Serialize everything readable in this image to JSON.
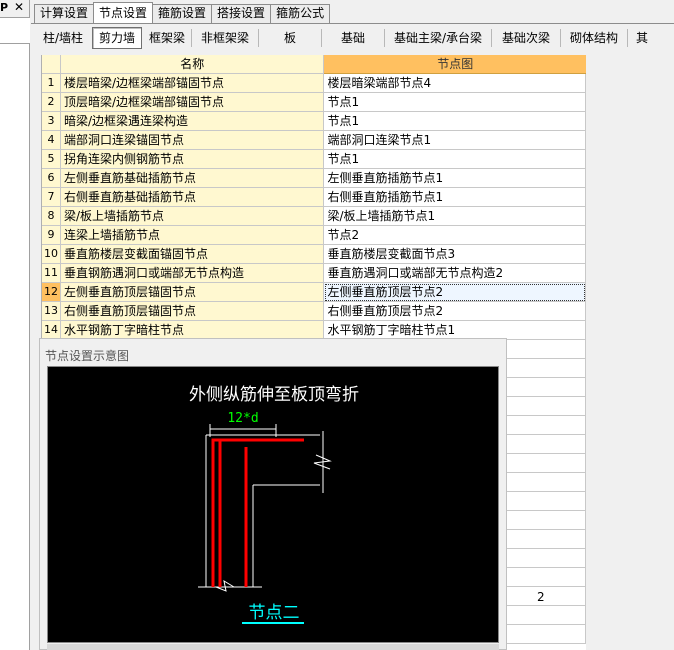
{
  "left_panel": {
    "glyph": "P",
    "close": "✕"
  },
  "tabs": [
    {
      "label": "计算设置",
      "active": false
    },
    {
      "label": "节点设置",
      "active": true
    },
    {
      "label": "箍筋设置",
      "active": false
    },
    {
      "label": "搭接设置",
      "active": false
    },
    {
      "label": "箍筋公式",
      "active": false
    }
  ],
  "subtabs": [
    {
      "label": "柱/墙柱",
      "active": false
    },
    {
      "label": "剪力墙",
      "active": true
    },
    {
      "label": "框架梁",
      "active": false
    },
    {
      "label": "非框架梁",
      "active": false
    },
    {
      "label": "板",
      "active": false
    },
    {
      "label": "基础",
      "active": false
    },
    {
      "label": "基础主梁/承台梁",
      "active": false
    },
    {
      "label": "基础次梁",
      "active": false
    },
    {
      "label": "砌体结构",
      "active": false
    },
    {
      "label": "其",
      "active": false
    }
  ],
  "table": {
    "headers": {
      "name": "名称",
      "node": "节点图"
    },
    "selected_row": 12,
    "rows": [
      {
        "num": "1",
        "name": "楼层暗梁/边框梁端部锚固节点",
        "node": "楼层暗梁端部节点4"
      },
      {
        "num": "2",
        "name": "顶层暗梁/边框梁端部锚固节点",
        "node": "节点1"
      },
      {
        "num": "3",
        "name": "暗梁/边框梁遇连梁构造",
        "node": "节点1"
      },
      {
        "num": "4",
        "name": "端部洞口连梁锚固节点",
        "node": "端部洞口连梁节点1"
      },
      {
        "num": "5",
        "name": "拐角连梁内侧钢筋节点",
        "node": "节点1"
      },
      {
        "num": "6",
        "name": "左侧垂直筋基础插筋节点",
        "node": "左侧垂直筋插筋节点1"
      },
      {
        "num": "7",
        "name": "右侧垂直筋基础插筋节点",
        "node": "右侧垂直筋插筋节点1"
      },
      {
        "num": "8",
        "name": "梁/板上墙插筋节点",
        "node": "梁/板上墙插筋节点1"
      },
      {
        "num": "9",
        "name": "连梁上墙插筋节点",
        "node": "节点2"
      },
      {
        "num": "10",
        "name": "垂直筋楼层变截面锚固节点",
        "node": "垂直筋楼层变截面节点3"
      },
      {
        "num": "11",
        "name": "垂直钢筋遇洞口或端部无节点构造",
        "node": "垂直筋遇洞口或端部无节点构造2"
      },
      {
        "num": "12",
        "name": "左侧垂直筋顶层锚固节点",
        "node": "左侧垂直筋顶层节点2"
      },
      {
        "num": "13",
        "name": "右侧垂直筋顶层锚固节点",
        "node": "右侧垂直筋顶层节点2"
      },
      {
        "num": "14",
        "name": "水平钢筋丁字暗柱节点",
        "node": "水平钢筋丁字暗柱节点1"
      }
    ],
    "stray_text": "2"
  },
  "schematic": {
    "title": "节点设置示意图",
    "caption": "外侧纵筋伸至板顶弯折",
    "dim_label": "12*d",
    "node_label": "节点二",
    "colors": {
      "bg": "#000000",
      "line": "#ffffff",
      "rebar": "#ff0000",
      "dim": "#00ff00",
      "label": "#00ffff"
    }
  }
}
